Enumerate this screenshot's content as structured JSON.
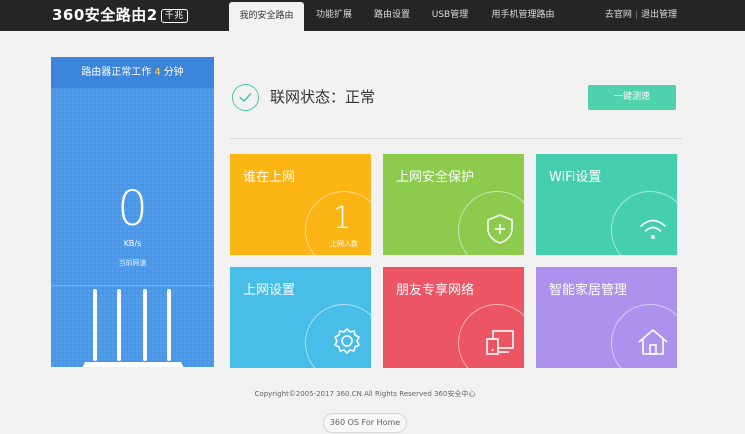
{
  "header": {
    "logo_text": "360安全路由2",
    "logo_badge": "千兆",
    "nav": [
      {
        "label": "我的安全路由",
        "active": true
      },
      {
        "label": "功能扩展",
        "active": false
      },
      {
        "label": "路由设置",
        "active": false
      },
      {
        "label": "USB管理",
        "active": false
      },
      {
        "label": "用手机管理路由",
        "active": false
      }
    ],
    "links": {
      "official": "去官网",
      "separator": "|",
      "logout": "退出管理"
    }
  },
  "status_panel": {
    "uptime_prefix": "路由器正常工作",
    "uptime_value": "4",
    "uptime_unit": "分钟",
    "speed_value": "0",
    "speed_unit": "KB/s",
    "speed_label": "当前网速"
  },
  "connection": {
    "status_text": "联网状态：正常",
    "speedtest_label": "一键测速"
  },
  "tiles": [
    {
      "id": "who-online",
      "title": "谁在上网",
      "count": "1",
      "count_label": "上网人数",
      "color": "#fbb514",
      "icon": "count"
    },
    {
      "id": "security",
      "title": "上网安全保护",
      "color": "#8ccb4e",
      "icon": "shield-plus-icon"
    },
    {
      "id": "wifi",
      "title": "WiFi设置",
      "color": "#45cfae",
      "icon": "wifi-icon"
    },
    {
      "id": "internet-settings",
      "title": "上网设置",
      "color": "#47bde8",
      "icon": "gear-icon"
    },
    {
      "id": "friend-network",
      "title": "朋友专享网络",
      "color": "#ec5563",
      "icon": "devices-icon"
    },
    {
      "id": "smart-home",
      "title": "智能家居管理",
      "color": "#ac92ec",
      "icon": "home-icon"
    }
  ],
  "footer": {
    "copyright": "Copyright©2005-2017 360.CN All Rights Reserved 360安全中心",
    "os_button": "360 OS For Home"
  }
}
